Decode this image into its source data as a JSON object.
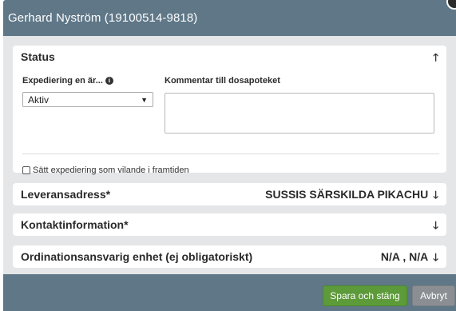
{
  "modal": {
    "title": "Gerhard Nyström (19100514-9818)"
  },
  "status": {
    "header": "Status",
    "expedition_label": "Expediering en är...",
    "expedition_value": "Aktiv",
    "comment_label": "Kommentar till dosapoteket",
    "comment_value": "",
    "checkbox_label": "Sätt expediering som vilande i framtiden"
  },
  "sections": [
    {
      "label": "Leveransadress*",
      "value": "SUSSIS SÄRSKILDA PIKACHU"
    },
    {
      "label": "Kontaktinformation*",
      "value": ""
    },
    {
      "label": "Ordinationsansvarig enhet (ej obligatoriskt)",
      "value": "N/A , N/A"
    }
  ],
  "buttons": {
    "save": "Spara och stäng",
    "cancel": "Avbryt"
  },
  "icons": {
    "collapse": "arrow-up-icon",
    "expand": "arrow-down-icon",
    "info": "info-icon",
    "caret": "caret-down-icon"
  }
}
